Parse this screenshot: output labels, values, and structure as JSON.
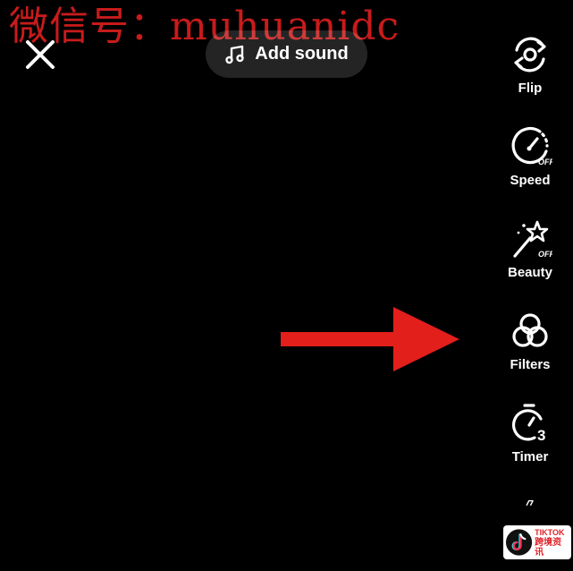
{
  "watermark": "微信号：muhuanidc",
  "top_bar": {
    "add_sound_label": "Add sound"
  },
  "tools": [
    {
      "label": "Flip",
      "icon": "flip-camera-icon"
    },
    {
      "label": "Speed",
      "icon": "speed-icon",
      "badge": "OFF"
    },
    {
      "label": "Beauty",
      "icon": "beauty-wand-icon",
      "badge": "OFF"
    },
    {
      "label": "Filters",
      "icon": "filters-icon"
    },
    {
      "label": "Timer",
      "icon": "timer-icon",
      "badge": "3"
    }
  ],
  "logo": {
    "line1": "TIKTOK",
    "line2": "跨境资讯"
  },
  "colors": {
    "background": "#000000",
    "arrow": "#e21f1a",
    "watermark": "#c81b1b",
    "pill": "rgba(255,255,255,0.14)"
  }
}
